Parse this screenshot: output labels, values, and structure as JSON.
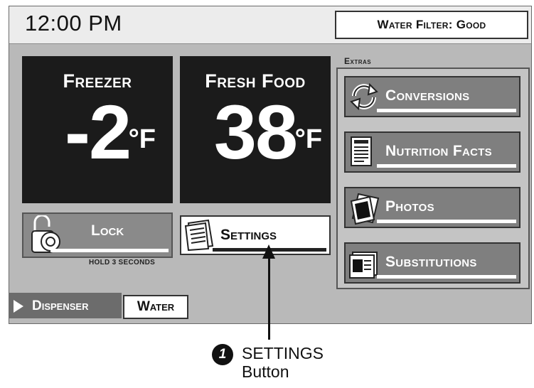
{
  "header": {
    "time": "12:00 PM",
    "water_filter_status": "Water Filter: Good"
  },
  "temperatures": {
    "freezer": {
      "label": "Freezer",
      "value": "-2",
      "unit": "°F"
    },
    "fresh_food": {
      "label": "Fresh Food",
      "value": "38",
      "unit": "°F"
    }
  },
  "controls": {
    "lock_label": "Lock",
    "lock_hint": "HOLD 3 SECONDS",
    "settings_label": "Settings"
  },
  "extras": {
    "title": "Extras",
    "items": [
      {
        "label": "Conversions",
        "icon": "conversions-icon"
      },
      {
        "label": "Nutrition Facts",
        "icon": "nutrition-facts-icon"
      },
      {
        "label": "Photos",
        "icon": "photos-icon"
      },
      {
        "label": "Substitutions",
        "icon": "substitutions-icon"
      }
    ]
  },
  "bottom": {
    "dispenser_label": "Dispenser",
    "water_label": "Water"
  },
  "callout": {
    "number": "1",
    "line1": "SETTINGS",
    "line2": "Button"
  }
}
